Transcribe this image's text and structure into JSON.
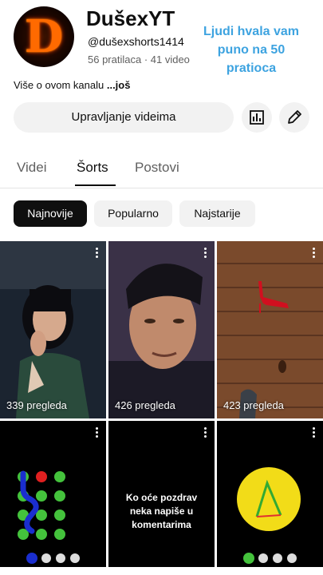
{
  "channel": {
    "name": "DušexYT",
    "handle": "@dušexshorts1414",
    "stats": "56 pratilaca · 41 video",
    "avatar_letter": "D",
    "about": "Više o ovom kanalu",
    "about_more": "...još"
  },
  "overlay_caption": "Ljudi hvala vam puno na 50 pratioca",
  "actions": {
    "manage_label": "Upravljanje videima",
    "analytics_icon": "bar-chart-icon",
    "edit_icon": "pencil-icon"
  },
  "tabs": [
    {
      "label": "Videi",
      "active": false
    },
    {
      "label": "Šorts",
      "active": true
    },
    {
      "label": "Postovi",
      "active": false
    }
  ],
  "chips": [
    {
      "label": "Najnovije",
      "active": true
    },
    {
      "label": "Popularno",
      "active": false
    },
    {
      "label": "Najstarije",
      "active": false
    }
  ],
  "shorts": [
    {
      "views": "339 pregleda"
    },
    {
      "views": "426 pregleda"
    },
    {
      "views": "423 pregleda"
    },
    {
      "views": ""
    },
    {
      "views": "",
      "text": "Ko oće pozdrav neka napiše u komentarima"
    },
    {
      "views": ""
    }
  ],
  "colors": {
    "accent_caption": "#3da3e0",
    "chip_active_bg": "#0f0f0f",
    "chip_bg": "#f2f2f2"
  }
}
